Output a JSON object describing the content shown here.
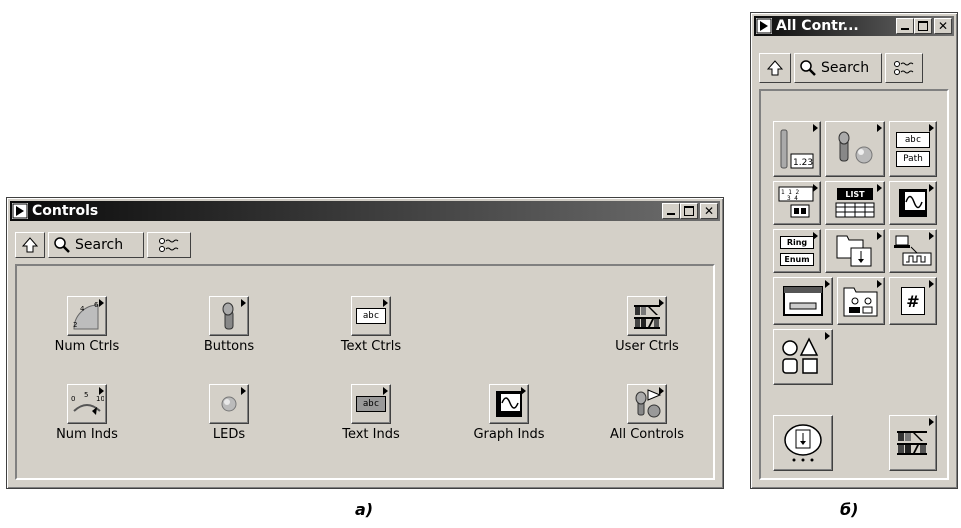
{
  "window_a": {
    "title": "Controls",
    "toolbar": {
      "search_label": "Search"
    },
    "palette": [
      {
        "label": "Num Ctrls",
        "icon": "num-ctrls-icon"
      },
      {
        "label": "Buttons",
        "icon": "buttons-icon"
      },
      {
        "label": "Text Ctrls",
        "icon": "text-ctrls-icon"
      },
      {
        "label": "User Ctrls",
        "icon": "user-ctrls-icon"
      },
      {
        "label": "Num Inds",
        "icon": "num-inds-icon"
      },
      {
        "label": "LEDs",
        "icon": "leds-icon"
      },
      {
        "label": "Text Inds",
        "icon": "text-inds-icon"
      },
      {
        "label": "Graph Inds",
        "icon": "graph-inds-icon"
      },
      {
        "label": "All Controls",
        "icon": "all-controls-icon"
      }
    ],
    "icon_text": {
      "abc": "abc"
    }
  },
  "window_b": {
    "title": "All Contr...",
    "toolbar": {
      "search_label": "Search"
    },
    "icon_text": {
      "num": "1.23",
      "abc": "abc",
      "path": "Path",
      "list": "LIST",
      "ring": "Ring",
      "enum": "Enum",
      "hash": "#"
    }
  },
  "captions": {
    "a": "a)",
    "b": "б)"
  },
  "colors": {
    "face": "#d4d0c8",
    "title_dark": "#0a0a0a",
    "title_light": "#6e6e6e"
  }
}
